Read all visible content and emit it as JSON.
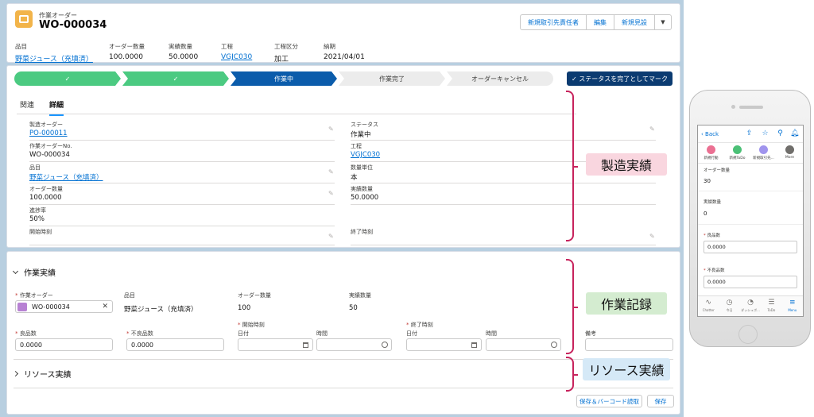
{
  "header": {
    "object_label": "作業オーダー",
    "record_name": "WO-000034",
    "buttons": [
      "新規取引先責任者",
      "編集",
      "新規見設"
    ],
    "more_label": "▼",
    "fields": [
      {
        "label": "品目",
        "value": "野菜ジュース（充填済）"
      },
      {
        "label": "オーダー数量",
        "value": "100.0000"
      },
      {
        "label": "実績数量",
        "value": "50.0000"
      },
      {
        "label": "工程",
        "value": "VGJC030"
      },
      {
        "label": "工程区分",
        "value": "加工"
      },
      {
        "label": "納期",
        "value": "2021/04/01"
      }
    ]
  },
  "path": {
    "steps": [
      "✓",
      "✓",
      "作業中",
      "作業完了",
      "オーダーキャンセル"
    ],
    "mark_button": "✓ ステータスを完了としてマーク"
  },
  "tabs": [
    "関連",
    "詳細"
  ],
  "details": {
    "left": [
      {
        "label": "製造オーダー",
        "value": "PO-000011"
      },
      {
        "label": "作業オーダーNo.",
        "value": "WO-000034"
      },
      {
        "label": "品目",
        "value": "野菜ジュース（充填済）"
      },
      {
        "label": "オーダー数量",
        "value": "100.0000"
      },
      {
        "label": "進捗率",
        "value": "50%"
      },
      {
        "label": "開始時刻",
        "value": ""
      }
    ],
    "right": [
      {
        "label": "ステータス",
        "value": "作業中"
      },
      {
        "label": "工程",
        "value": "VGJC030"
      },
      {
        "label": "数量単位",
        "value": "本"
      },
      {
        "label": "実績数量",
        "value": "50.0000"
      },
      {
        "label": "終了時刻",
        "value": ""
      }
    ]
  },
  "work": {
    "section_title": "作業実績",
    "work_order_label": "作業オーダー",
    "work_order_value": "WO-000034",
    "item_label": "品目",
    "item_value": "野菜ジュース（充填済）",
    "order_qty_label": "オーダー数量",
    "order_qty_value": "100",
    "actual_qty_label": "実績数量",
    "actual_qty_value": "50",
    "good_label": "良品数",
    "good_value": "0.0000",
    "bad_label": "不良品数",
    "bad_value": "0.0000",
    "start_label": "開始時刻",
    "end_label": "終了時刻",
    "date_label": "日付",
    "time_label": "時間",
    "note_label": "備考",
    "resource_title": "リソース実績",
    "save_barcode_button": "保存＆バーコード読取",
    "save_button": "保存"
  },
  "annotations": {
    "manufacturing": "製造実績",
    "work_record": "作業記録",
    "resource": "リソース実績",
    "colors": {
      "brace": "#c7235d",
      "manufacturing_bg": "#f9d6df",
      "work_bg": "#d4ecd0",
      "resource_bg": "#d5e9f7"
    }
  },
  "mobile": {
    "back": "Back",
    "actions": [
      "新規行動",
      "新規ToDo",
      "新規取引先...",
      "More"
    ],
    "fields": [
      {
        "label": "オーダー数量",
        "value": "30"
      },
      {
        "label": "実績数量",
        "value": "0"
      }
    ],
    "good_label": "良品数",
    "good_value": "0.0000",
    "bad_label": "不良品数",
    "bad_value": "0.0000",
    "tabbar": [
      "Chatter",
      "今日",
      "ダッシュボ...",
      "ToDo",
      "Menu"
    ]
  }
}
